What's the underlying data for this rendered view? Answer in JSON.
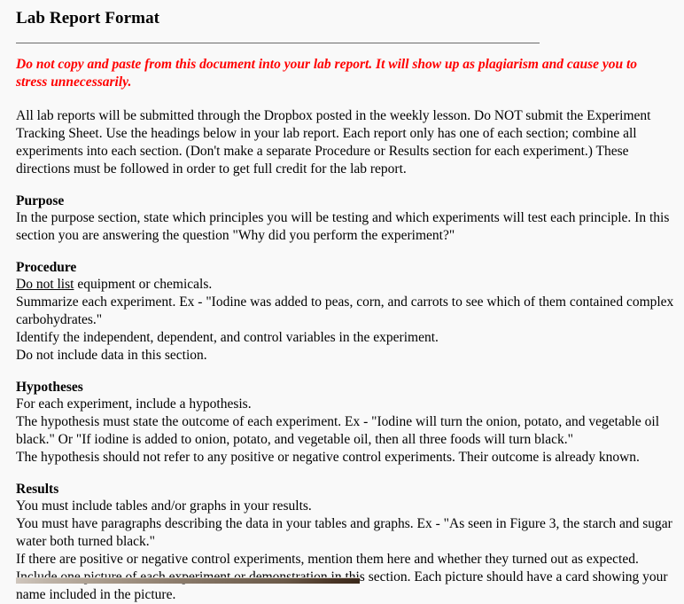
{
  "document": {
    "title": "Lab Report Format",
    "warning": "Do not copy and paste from this document into your lab report.  It will show up as plagiarism and cause you to stress unnecessarily.",
    "intro_paragraph": "All lab reports will be submitted through the Dropbox posted in the weekly lesson.  Do NOT submit the Experiment Tracking Sheet.  Use the headings below in your lab report.  Each report only has one of each section; combine all experiments into each section.  (Don't make a separate Procedure or Results section for each experiment.)  These directions must be followed in order to get full credit for the lab report.",
    "colors": {
      "warning_text": "#ff0000",
      "body_text": "#000000",
      "page_background": "#f9f9f9",
      "rule": "#6b6b6b"
    },
    "sections": [
      {
        "heading": "Purpose",
        "lines": [
          "In the purpose section, state which principles you will be testing and which experiments will test each principle. In this section you are answering the question \"Why did you perform the experiment?\""
        ]
      },
      {
        "heading": "Procedure",
        "lines": [
          "Do not list equipment or chemicals.",
          "Summarize each experiment. Ex - \"Iodine was added to peas, corn, and carrots to see which of them contained complex carbohydrates.\"",
          "Identify the independent, dependent, and control variables in the experiment.",
          "Do not include data in this section."
        ],
        "procedure_line1_underlined": "Do not list",
        "procedure_line1_rest": " equipment or chemicals."
      },
      {
        "heading": "Hypotheses",
        "lines": [
          "For each experiment, include a hypothesis.",
          "The hypothesis must state the outcome of each experiment.  Ex - \"Iodine will turn the onion, potato, and vegetable oil black.\"  Or \"If iodine is added to onion, potato, and vegetable oil, then all three foods will turn black.\"",
          "The hypothesis should not refer to any positive or negative control experiments.  Their outcome is already known."
        ]
      },
      {
        "heading": "Results",
        "lines": [
          "You must include tables and/or graphs in your results.",
          "You must have paragraphs describing the data in your tables and graphs.  Ex - \"As seen in Figure 3, the starch and sugar water both turned black.\"",
          "If there are positive or negative control experiments, mention them here and whether they turned out as expected."
        ],
        "results_last_prefix": "Include ",
        "results_last_underlined": "one picture of each experiment or demonstration",
        "results_last_rest": " in this section.  Each picture should have a card showing your name included in the picture."
      }
    ]
  }
}
